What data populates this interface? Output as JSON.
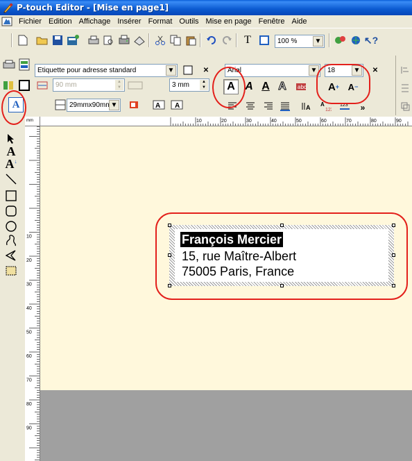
{
  "window": {
    "title": "P-touch Editor - [Mise en page1]"
  },
  "menu": [
    {
      "label": "Fichier"
    },
    {
      "label": "Edition"
    },
    {
      "label": "Affichage"
    },
    {
      "label": "Insérer"
    },
    {
      "label": "Format"
    },
    {
      "label": "Outils"
    },
    {
      "label": "Mise en page"
    },
    {
      "label": "Fenêtre"
    },
    {
      "label": "Aide"
    }
  ],
  "standard_toolbar": {
    "zoom_value": "100 %",
    "text_button": "T"
  },
  "layout_toolbar": {
    "label_type": "Etiquette pour adresse standard",
    "width_value": "90 mm",
    "margin_value": "3 mm",
    "size_value": "29mmx90mm"
  },
  "font_toolbar": {
    "font_name": "Arial",
    "font_size": "18",
    "bold_label": "A",
    "italic_label": "A",
    "underline_label": "A",
    "outline_label": "A",
    "grow_label": "A",
    "shrink_label": "A",
    "more_label": "»"
  },
  "ruler": {
    "h_marks": [
      "10",
      "20",
      "30",
      "40",
      "50",
      "60",
      "70",
      "80",
      "90"
    ],
    "v_marks": [
      "10",
      "20",
      "30",
      "40",
      "50",
      "60",
      "70",
      "80",
      "90"
    ]
  },
  "label": {
    "lines": [
      "François Mercier",
      "15, rue Maître-Albert",
      "75005 Paris, France"
    ]
  },
  "colors": {
    "title_bar": "#0a5ed8",
    "canvas": "#fff8dc",
    "annotation": "#e3201b",
    "workspace": "#a0a0a0"
  }
}
